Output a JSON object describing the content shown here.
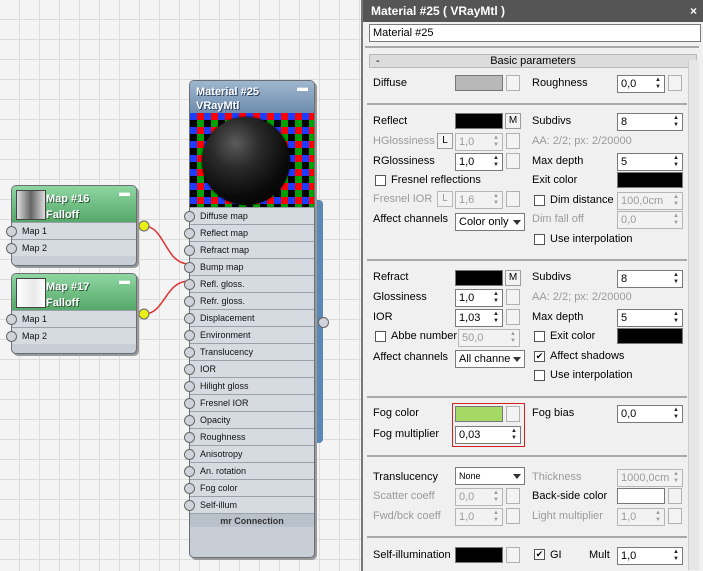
{
  "schematic": {
    "map16": {
      "title": "Map #16",
      "subtitle": "Falloff",
      "slots": [
        "Map 1",
        "Map 2"
      ]
    },
    "map17": {
      "title": "Map #17",
      "subtitle": "Falloff",
      "slots": [
        "Map 1",
        "Map 2"
      ]
    },
    "material": {
      "title": "Material #25",
      "subtitle": "VRayMtl",
      "footer": "mr Connection",
      "slots": [
        "Diffuse map",
        "Reflect map",
        "Refract map",
        "Bump map",
        "Refl. gloss.",
        "Refr. gloss.",
        "Displacement",
        "Environment",
        "Translucency",
        "IOR",
        "Hilight gloss",
        "Fresnel IOR",
        "Opacity",
        "Roughness",
        "Anisotropy",
        "An. rotation",
        "Fog color",
        "Self-illum"
      ]
    },
    "minimize_glyph": "▬"
  },
  "panel": {
    "title": "Material #25  ( VRayMtl )",
    "close": "×",
    "name_value": "Material #25",
    "rollout_sign": "-",
    "rollout_title": "Basic parameters",
    "diffuse": {
      "label": "Diffuse",
      "color": "#b8b8b8",
      "roughness_label": "Roughness",
      "roughness": "0,0"
    },
    "reflect": {
      "label": "Reflect",
      "color": "#000000",
      "m": "M",
      "subdivs_label": "Subdivs",
      "subdivs": "8",
      "aa_text": "AA: 2/2; px: 2/20000",
      "hgloss_label": "HGlossiness",
      "l_btn": "L",
      "hgloss": "1,0",
      "rgloss_label": "RGlossiness",
      "rgloss": "1,0",
      "maxdepth_label": "Max depth",
      "maxdepth": "5",
      "fresnel_label": "Fresnel reflections",
      "exit_label": "Exit color",
      "exit_color": "#000000",
      "fior_label": "Fresnel IOR",
      "fior": "1,6",
      "dim_label": "Dim distance",
      "dim": "100,0cm",
      "affect_label": "Affect channels",
      "affect": "Color only",
      "dimfall_label": "Dim fall off",
      "dimfall": "0,0",
      "interp_label": "Use interpolation"
    },
    "refract": {
      "label": "Refract",
      "color": "#000000",
      "m": "M",
      "subdivs_label": "Subdivs",
      "subdivs": "8",
      "aa_text": "AA: 2/2; px: 2/20000",
      "gloss_label": "Glossiness",
      "gloss": "1,0",
      "ior_label": "IOR",
      "ior": "1,03",
      "maxdepth_label": "Max depth",
      "maxdepth": "5",
      "abbe_label": "Abbe number",
      "abbe": "50,0",
      "exit_label": "Exit color",
      "exit_color": "#000000",
      "affect_label": "Affect channels",
      "affect": "All channe",
      "shadows_label": "Affect shadows",
      "check": "✔",
      "interp_label": "Use interpolation"
    },
    "fog": {
      "color_label": "Fog color",
      "color": "#a6d866",
      "mult_label": "Fog multiplier",
      "mult": "0,03",
      "bias_label": "Fog bias",
      "bias": "0,0"
    },
    "translucency": {
      "label": "Translucency",
      "mode": "None",
      "thick_label": "Thickness",
      "thick": "1000,0cm",
      "scatter_label": "Scatter coeff",
      "scatter": "0,0",
      "backside_label": "Back-side color",
      "backside_color": "#ffffff",
      "fwd_label": "Fwd/bck coeff",
      "fwd": "1,0",
      "lightmult_label": "Light multiplier",
      "lightmult": "1,0"
    },
    "selfillum": {
      "label": "Self-illumination",
      "color": "#000000",
      "gi_label": "GI",
      "mult_label": "Mult",
      "mult": "1,0"
    }
  }
}
